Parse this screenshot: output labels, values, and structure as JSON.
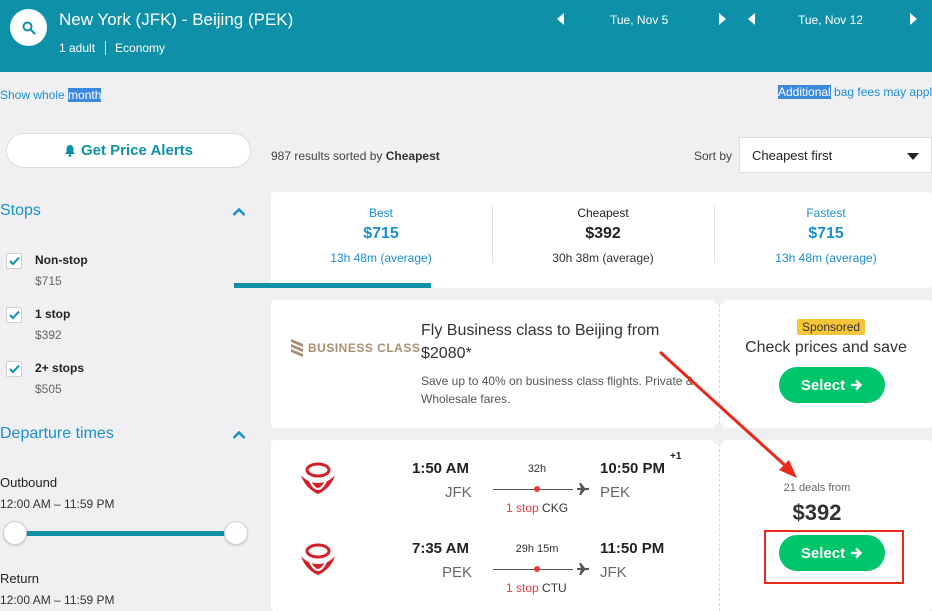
{
  "header": {
    "route": "New York (JFK) - Beijing (PEK)",
    "passengers": "1 adult",
    "cabin": "Economy",
    "depart_date": "Tue, Nov 5",
    "return_date": "Tue, Nov 12"
  },
  "links": {
    "show_whole_prefix": "Show whole ",
    "show_whole_highlight": "month",
    "bag_fees_highlight": "Additional",
    "bag_fees_rest": " bag fees may appl"
  },
  "sidebar": {
    "price_alert_label": "Get Price Alerts",
    "stops_title": "Stops",
    "stops": [
      {
        "label": "Non-stop",
        "price": "$715"
      },
      {
        "label": "1 stop",
        "price": "$392"
      },
      {
        "label": "2+ stops",
        "price": "$505"
      }
    ],
    "departure_title": "Departure times",
    "outbound_label": "Outbound",
    "outbound_range": "12:00 AM – 11:59 PM",
    "return_label": "Return",
    "return_range": "12:00 AM – 11:59 PM"
  },
  "results": {
    "count_text": "987 results sorted by ",
    "sorted_by": "Cheapest",
    "sort_label": "Sort by",
    "sort_value": "Cheapest first"
  },
  "tabs": [
    {
      "name": "Best",
      "price": "$715",
      "duration": "13h 48m (average)"
    },
    {
      "name": "Cheapest",
      "price": "$392",
      "duration": "30h 38m (average)"
    },
    {
      "name": "Fastest",
      "price": "$715",
      "duration": "13h 48m (average)"
    }
  ],
  "ad": {
    "brand": "BUSINESS CLASS",
    "title": "Fly Business class to Beijing from $2080*",
    "description_line1": "Save up to 40% on business class flights. Private &",
    "description_line2": "Wholesale fares.",
    "sponsored": "Sponsored",
    "cta_text": "Check prices and save",
    "select_label": "Select"
  },
  "flight": {
    "outbound": {
      "depart_time": "1:50 AM",
      "depart_code": "JFK",
      "duration": "32h",
      "stops_label": "1 stop",
      "via": "CKG",
      "arrive_time": "10:50 PM",
      "arrive_code": "PEK",
      "day_offset": "+1"
    },
    "return": {
      "depart_time": "7:35 AM",
      "depart_code": "PEK",
      "duration": "29h 15m",
      "stops_label": "1 stop",
      "via": "CTU",
      "arrive_time": "11:50 PM",
      "arrive_code": "JFK"
    },
    "deals_text": "21 deals from",
    "price": "$392",
    "select_label": "Select"
  },
  "colors": {
    "brand_teal": "#0e91a8",
    "select_green": "#00c66b",
    "link_blue": "#1a8fd0",
    "annotation_red": "#e8291c"
  }
}
